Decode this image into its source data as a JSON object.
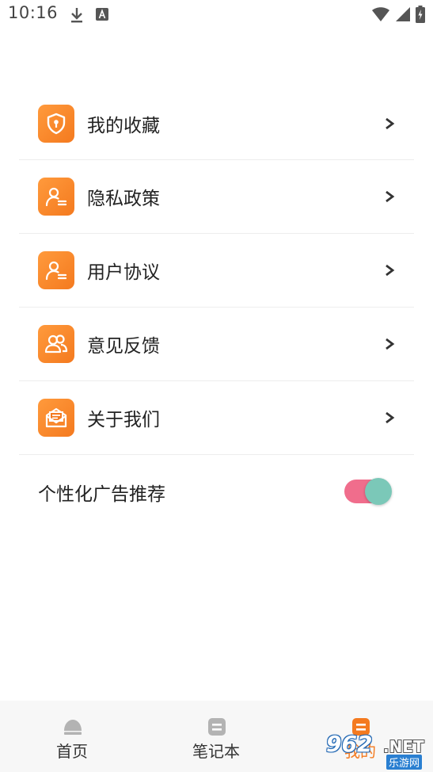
{
  "status_bar": {
    "time": "10:16",
    "icons": [
      "download-icon",
      "a-icon",
      "wifi-icon",
      "signal-icon",
      "battery-icon"
    ]
  },
  "menu": {
    "items": [
      {
        "label": "我的收藏",
        "icon": "shield-icon"
      },
      {
        "label": "隐私政策",
        "icon": "user-doc-icon"
      },
      {
        "label": "用户协议",
        "icon": "user-doc-icon"
      },
      {
        "label": "意见反馈",
        "icon": "users-icon"
      },
      {
        "label": "关于我们",
        "icon": "mail-icon"
      }
    ],
    "arrow_glyph": "chevron-right-icon"
  },
  "ad_setting": {
    "label": "个性化广告推荐",
    "enabled": true
  },
  "tab_bar": {
    "tabs": [
      {
        "label": "首页",
        "icon": "home-icon",
        "active": false
      },
      {
        "label": "笔记本",
        "icon": "notebook-icon",
        "active": false
      },
      {
        "label": "我的",
        "icon": "profile-icon",
        "active": true
      }
    ]
  },
  "watermark": {
    "number": "962",
    "suffix": ".NET",
    "sub": "乐游网"
  },
  "colors": {
    "accent": "#f47a1f",
    "toggle_track": "#f06d8c",
    "toggle_knob": "#7bc8b8",
    "divider": "#ededed",
    "tab_bar_bg": "#f7f7f7"
  }
}
